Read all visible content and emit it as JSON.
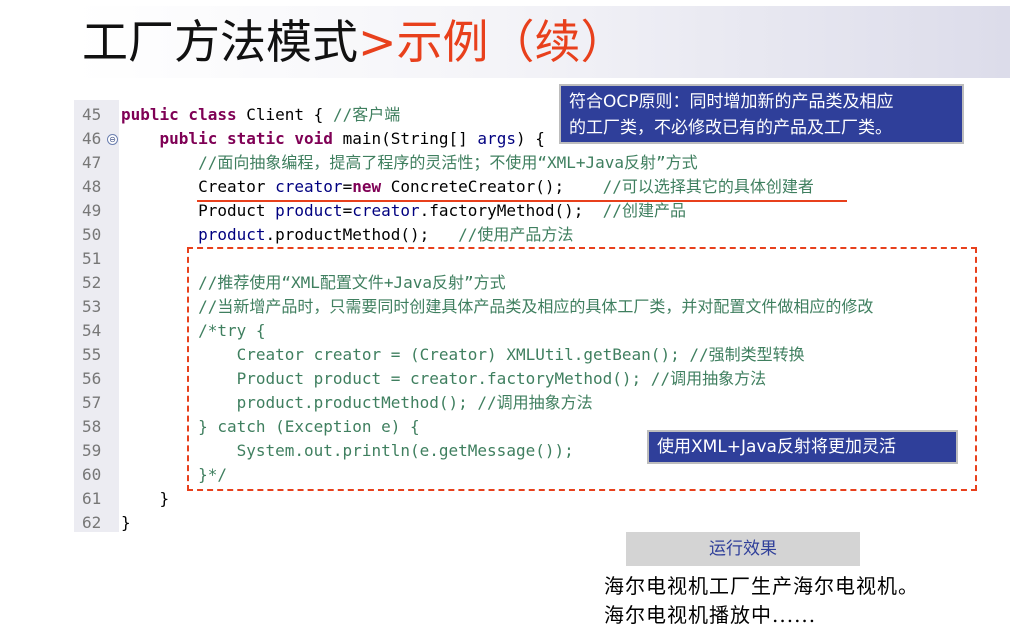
{
  "slide": {
    "title_main": "工厂方法模式",
    "title_sep": ">",
    "title_sub": "示例（续）"
  },
  "callouts": {
    "ocp_line1": "符合OCP原则：同时增加新的产品类及相应",
    "ocp_line2": "的工厂类，不必修改已有的产品及工厂类。",
    "xml": "使用XML+Java反射将更加灵活"
  },
  "code": {
    "fold_marker": "⊖",
    "lines": [
      {
        "n": "45",
        "parts": [
          [
            "kw",
            "public class "
          ],
          [
            "txt",
            "Client { "
          ],
          [
            "cm",
            "//客户端"
          ]
        ]
      },
      {
        "n": "46",
        "parts": [
          [
            "txt",
            "    "
          ],
          [
            "kw",
            "public static void "
          ],
          [
            "txt",
            "main(String[] "
          ],
          [
            "vn",
            "args"
          ],
          [
            "txt",
            ") {"
          ]
        ]
      },
      {
        "n": "47",
        "parts": [
          [
            "txt",
            "        "
          ],
          [
            "cm",
            "//面向抽象编程，提高了程序的灵活性；不使用“XML+Java反射”方式"
          ]
        ]
      },
      {
        "n": "48",
        "parts": [
          [
            "txt",
            "        Creator "
          ],
          [
            "vn",
            "creator"
          ],
          [
            "txt",
            "="
          ],
          [
            "kw",
            "new "
          ],
          [
            "txt",
            "ConcreteCreator();    "
          ],
          [
            "cm",
            "//可以选择其它的具体创建者"
          ]
        ]
      },
      {
        "n": "49",
        "parts": [
          [
            "txt",
            "        Product "
          ],
          [
            "vn",
            "product"
          ],
          [
            "txt",
            "="
          ],
          [
            "vn",
            "creator"
          ],
          [
            "txt",
            ".factoryMethod();  "
          ],
          [
            "cm",
            "//创建产品"
          ]
        ]
      },
      {
        "n": "50",
        "parts": [
          [
            "txt",
            "        "
          ],
          [
            "vn",
            "product"
          ],
          [
            "txt",
            ".productMethod();   "
          ],
          [
            "cm",
            "//使用产品方法"
          ]
        ]
      },
      {
        "n": "51",
        "parts": []
      },
      {
        "n": "52",
        "parts": [
          [
            "txt",
            "        "
          ],
          [
            "cm",
            "//推荐使用“XML配置文件+Java反射”方式"
          ]
        ]
      },
      {
        "n": "53",
        "parts": [
          [
            "txt",
            "        "
          ],
          [
            "cm",
            "//当新增产品时，只需要同时创建具体产品类及相应的具体工厂类，并对配置文件做相应的修改"
          ]
        ]
      },
      {
        "n": "54",
        "parts": [
          [
            "txt",
            "        "
          ],
          [
            "cm",
            "/*try {"
          ]
        ]
      },
      {
        "n": "55",
        "parts": [
          [
            "txt",
            "            "
          ],
          [
            "cm",
            "Creator creator = (Creator) XMLUtil.getBean(); //强制类型转换"
          ]
        ]
      },
      {
        "n": "56",
        "parts": [
          [
            "txt",
            "            "
          ],
          [
            "cm",
            "Product product = creator.factoryMethod(); //调用抽象方法"
          ]
        ]
      },
      {
        "n": "57",
        "parts": [
          [
            "txt",
            "            "
          ],
          [
            "cm",
            "product.productMethod(); //调用抽象方法"
          ]
        ]
      },
      {
        "n": "58",
        "parts": [
          [
            "txt",
            "        "
          ],
          [
            "cm",
            "} catch (Exception e) {"
          ]
        ]
      },
      {
        "n": "59",
        "parts": [
          [
            "txt",
            "            "
          ],
          [
            "cm",
            "System.out.println(e.getMessage());"
          ]
        ]
      },
      {
        "n": "60",
        "parts": [
          [
            "txt",
            "        "
          ],
          [
            "cm",
            "}*/"
          ]
        ]
      },
      {
        "n": "61",
        "parts": [
          [
            "txt",
            "    }"
          ]
        ]
      },
      {
        "n": "62",
        "parts": [
          [
            "txt",
            "}"
          ]
        ]
      }
    ]
  },
  "run": {
    "label": "运行效果",
    "output_line1": "海尔电视机工厂生产海尔电视机。",
    "output_line2": "海尔电视机播放中......"
  }
}
